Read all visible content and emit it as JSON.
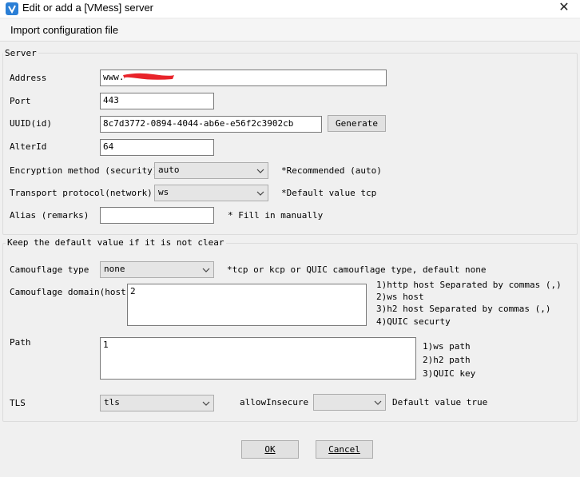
{
  "window": {
    "title": "Edit or add a [VMess] server",
    "close_glyph": "✕"
  },
  "menu": {
    "import_label": "Import configuration file"
  },
  "server_group": {
    "title": "Server",
    "address_label": "Address",
    "address_value": "www.",
    "port_label": "Port",
    "port_value": "443",
    "uuid_label": "UUID(id)",
    "uuid_value": "8c7d3772-0894-4044-ab6e-e56f2c3902cb",
    "generate_button": "Generate",
    "alterid_label": "AlterId",
    "alterid_value": "64",
    "security_label": "Encryption method (security)",
    "security_value": "auto",
    "security_hint": "*Recommended (auto)",
    "network_label": "Transport protocol(network)",
    "network_value": "ws",
    "network_hint": "*Default value tcp",
    "alias_label": "Alias (remarks)",
    "alias_value": "",
    "alias_hint": "* Fill in manually"
  },
  "advanced_group": {
    "title": "Keep the default value if it is not clear",
    "camouflage_type_label": "Camouflage type",
    "camouflage_type_value": "none",
    "camouflage_type_hint": "*tcp or kcp or QUIC camouflage type, default none",
    "host_label": "Camouflage domain(host)",
    "host_value": "2",
    "host_hints": [
      "1)http host Separated by commas (,)",
      "2)ws host",
      "3)h2 host Separated by commas (,)",
      "4)QUIC securty"
    ],
    "path_label": "Path",
    "path_value": "1",
    "path_hints": [
      "1)ws path",
      "2)h2 path",
      "3)QUIC key"
    ],
    "tls_label": "TLS",
    "tls_value": "tls",
    "allow_insecure_label": "allowInsecure",
    "allow_insecure_value": "",
    "allow_insecure_hint": "Default value true"
  },
  "footer": {
    "ok_label": "OK",
    "cancel_label": "Cancel"
  },
  "icons": {
    "app": "v2rayn-logo-icon",
    "chevron": "chevron-down-icon"
  },
  "colors": {
    "accent": "#2b7fd6",
    "redaction": "#e8232a"
  }
}
